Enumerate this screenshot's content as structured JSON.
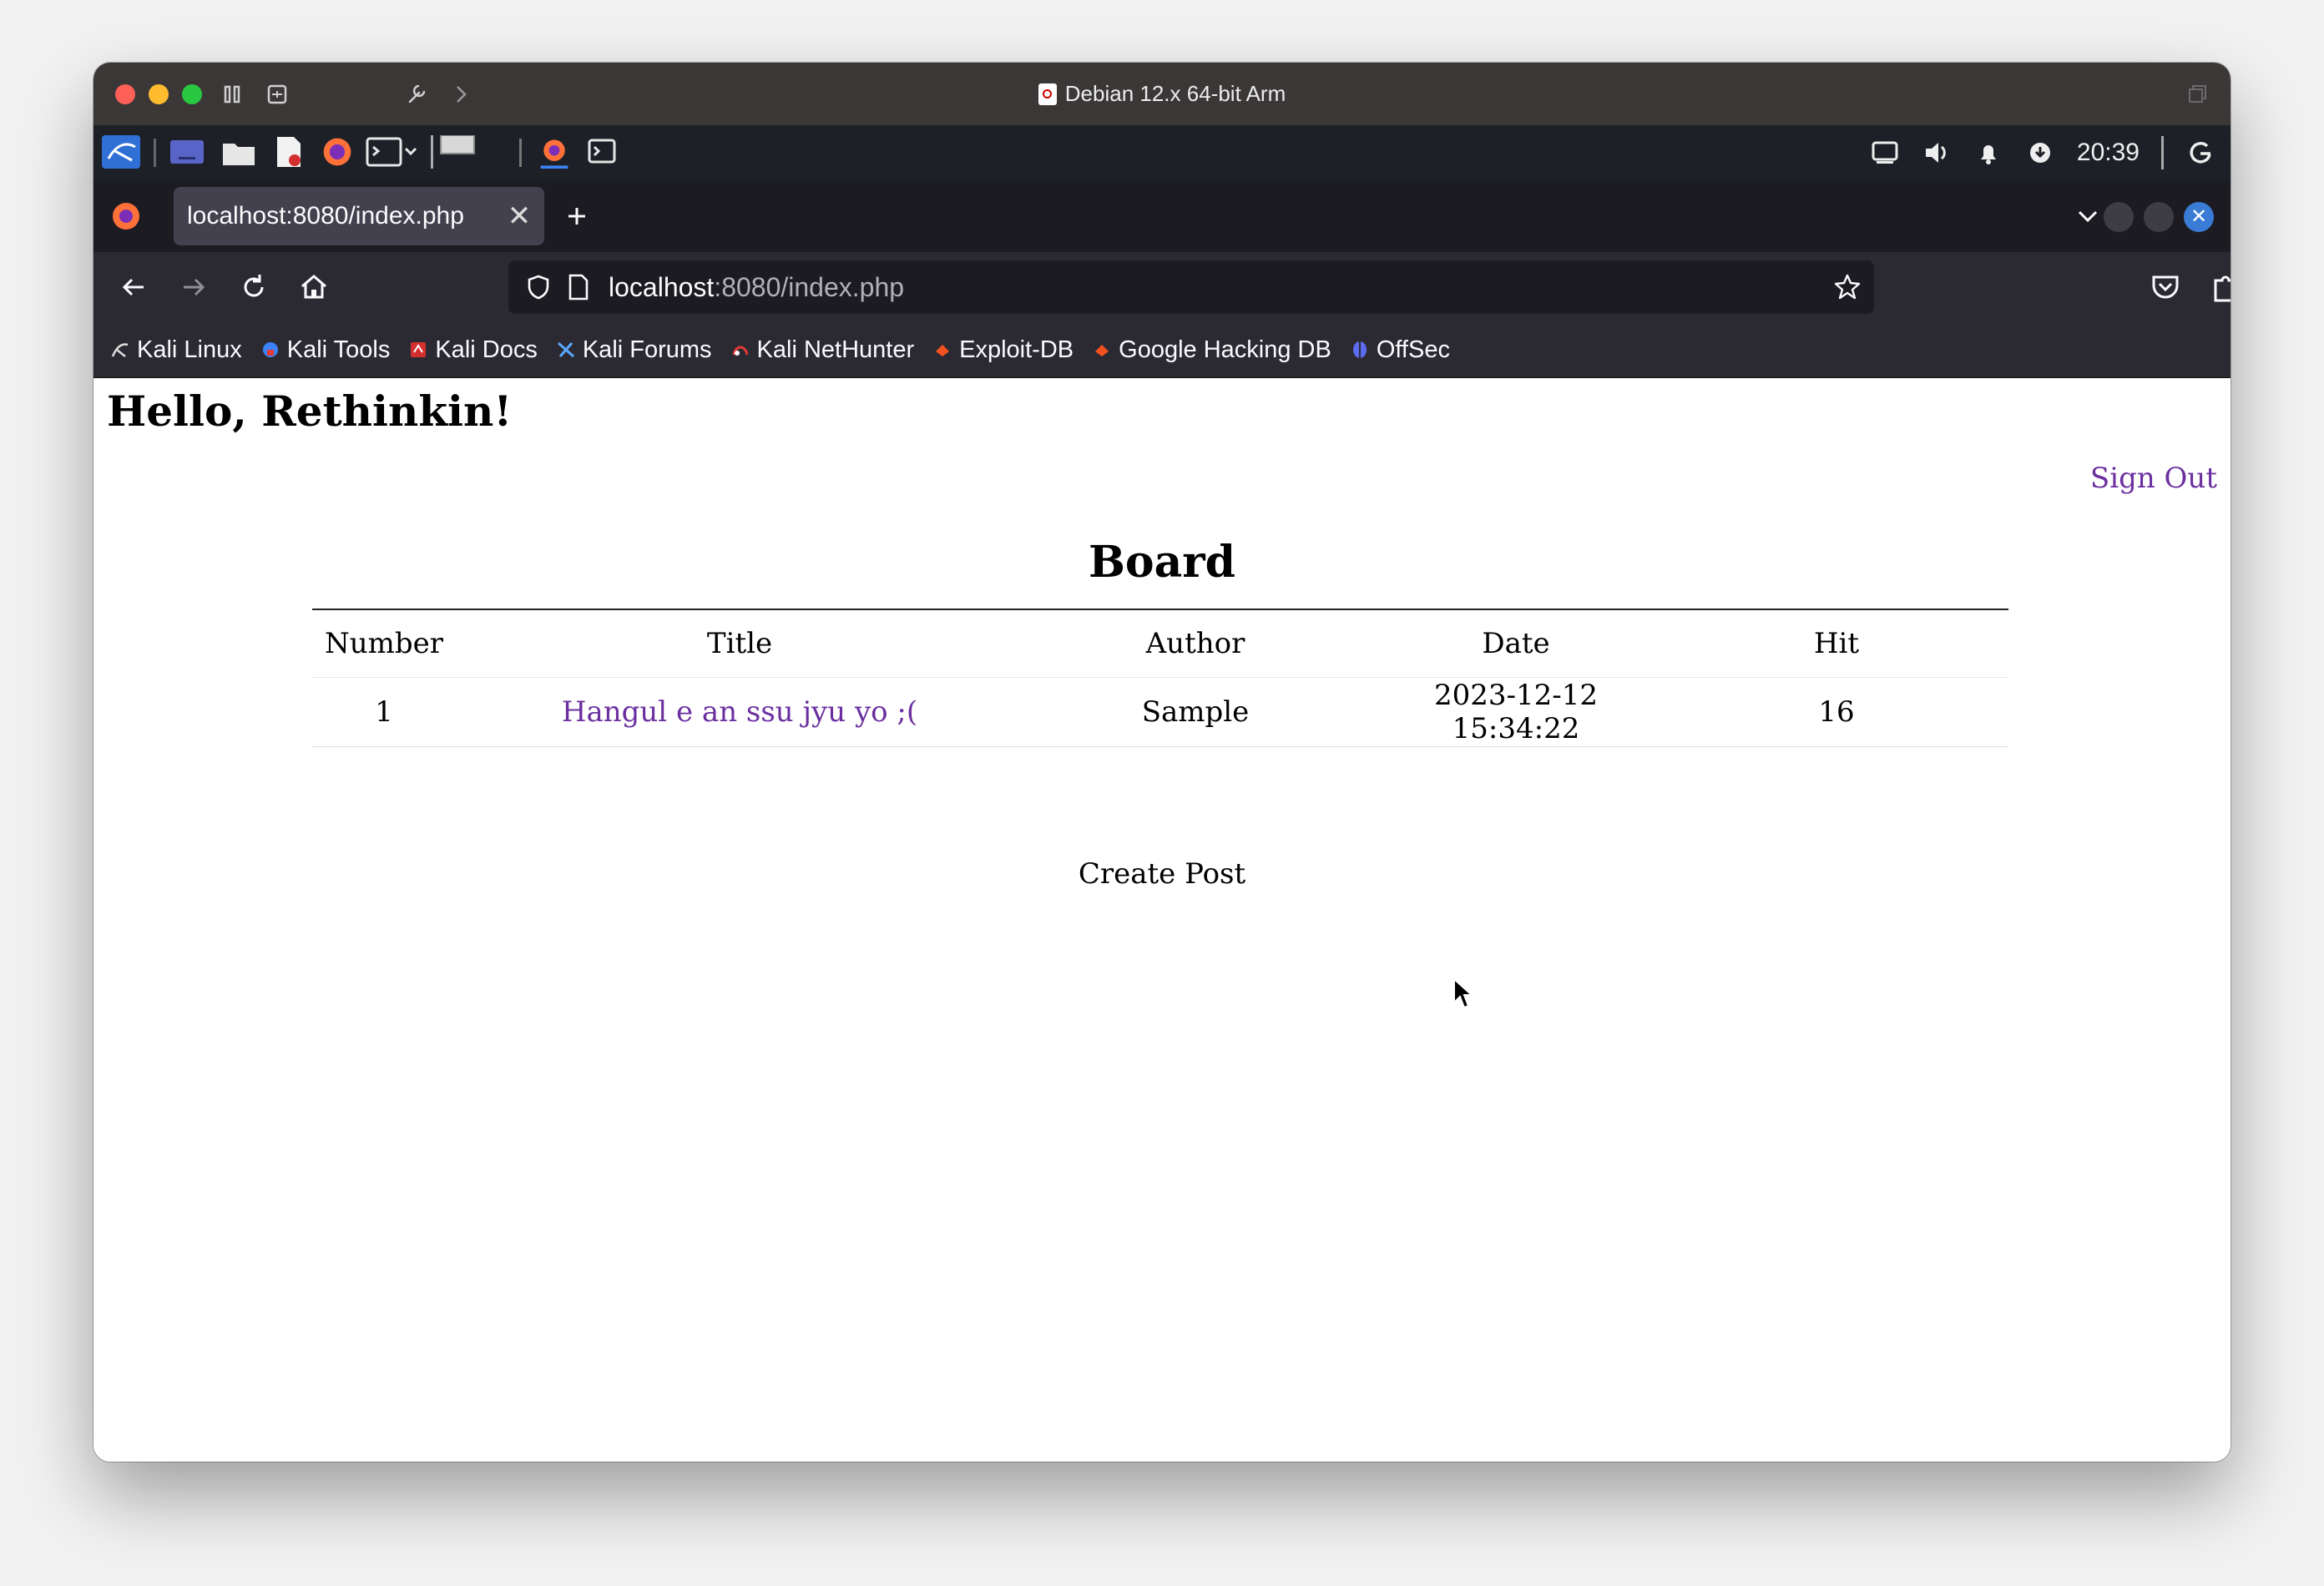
{
  "vm_window": {
    "title": "Debian 12.x 64-bit Arm"
  },
  "panel": {
    "clock": "20:39"
  },
  "browser": {
    "tab": {
      "title": "localhost:8080/index.php"
    },
    "url": {
      "host": "localhost",
      "rest": ":8080/index.php"
    },
    "bookmarks": [
      {
        "label": "Kali Linux",
        "icon": "kali-dragon-icon"
      },
      {
        "label": "Kali Tools",
        "icon": "kali-tools-icon"
      },
      {
        "label": "Kali Docs",
        "icon": "kali-docs-icon"
      },
      {
        "label": "Kali Forums",
        "icon": "kali-forums-icon"
      },
      {
        "label": "Kali NetHunter",
        "icon": "nethunter-icon"
      },
      {
        "label": "Exploit-DB",
        "icon": "exploit-db-icon"
      },
      {
        "label": "Google Hacking DB",
        "icon": "ghdb-icon"
      },
      {
        "label": "OffSec",
        "icon": "offsec-icon"
      }
    ]
  },
  "page": {
    "greeting": "Hello, Rethinkin!",
    "sign_out": "Sign Out",
    "board_title": "Board",
    "table": {
      "headers": [
        "Number",
        "Title",
        "Author",
        "Date",
        "Hit"
      ],
      "rows": [
        {
          "number": "1",
          "title": "Hangul e an ssu jyu yo ;(",
          "author": "Sample",
          "date": "2023-12-12 15:34:22",
          "hit": "16"
        }
      ]
    },
    "create_post": "Create Post"
  },
  "colors": {
    "link": "#6b2fa0",
    "mac_titlebar": "#3b3737",
    "firefox_toolbar": "#2b2a33",
    "firefox_tabstrip": "#1c1b22"
  }
}
